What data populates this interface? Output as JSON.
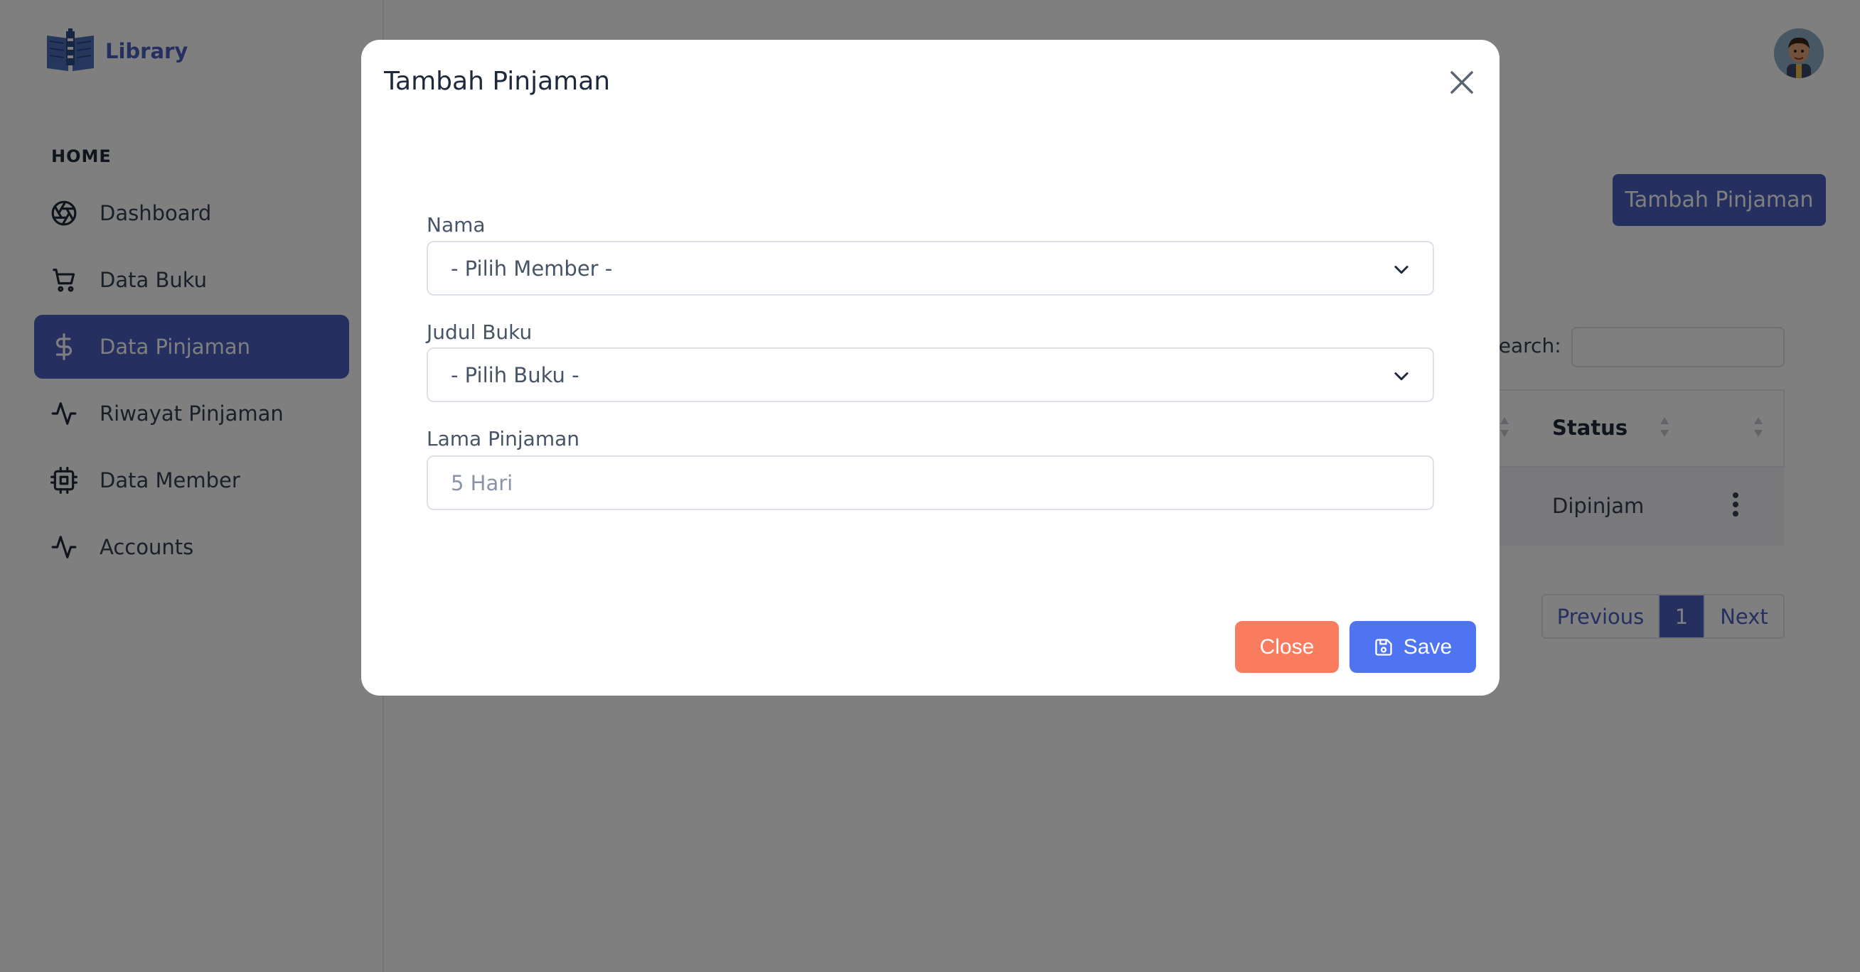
{
  "brand": {
    "name": "Library",
    "logo_icon": "library-book-logo"
  },
  "sidebar": {
    "heading": "HOME",
    "items": [
      {
        "label": "Dashboard",
        "icon": "aperture-icon",
        "active": false
      },
      {
        "label": "Data Buku",
        "icon": "cart-icon",
        "active": false
      },
      {
        "label": "Data Pinjaman",
        "icon": "dollar-icon",
        "active": true
      },
      {
        "label": "Riwayat Pinjaman",
        "icon": "activity-icon",
        "active": false
      },
      {
        "label": "Data Member",
        "icon": "cpu-icon",
        "active": false
      },
      {
        "label": "Accounts",
        "icon": "activity-icon",
        "active": false
      }
    ]
  },
  "header": {
    "avatar_icon": "user-avatar"
  },
  "page": {
    "add_button_label": "Tambah Pinjaman",
    "search_label": "Search:",
    "table": {
      "headers": [
        "Status",
        ""
      ],
      "rows": [
        {
          "status": "Dipinjam",
          "action_icon": "more-vertical-icon"
        }
      ]
    },
    "pagination": {
      "previous": "Previous",
      "current": "1",
      "next": "Next"
    }
  },
  "modal": {
    "title": "Tambah Pinjaman",
    "fields": {
      "nama": {
        "label": "Nama",
        "selected": "- Pilih Member -"
      },
      "judul_buku": {
        "label": "Judul Buku",
        "selected": "- Pilih Buku -"
      },
      "lama_pinjaman": {
        "label": "Lama Pinjaman",
        "placeholder": "5 Hari",
        "value": ""
      }
    },
    "buttons": {
      "close": "Close",
      "save": "Save"
    }
  },
  "colors": {
    "primary": "#4a5fc1",
    "save_button": "#4f74f2",
    "close_button": "#f97c5e",
    "overlay": "rgba(0,0,0,0.5)"
  }
}
